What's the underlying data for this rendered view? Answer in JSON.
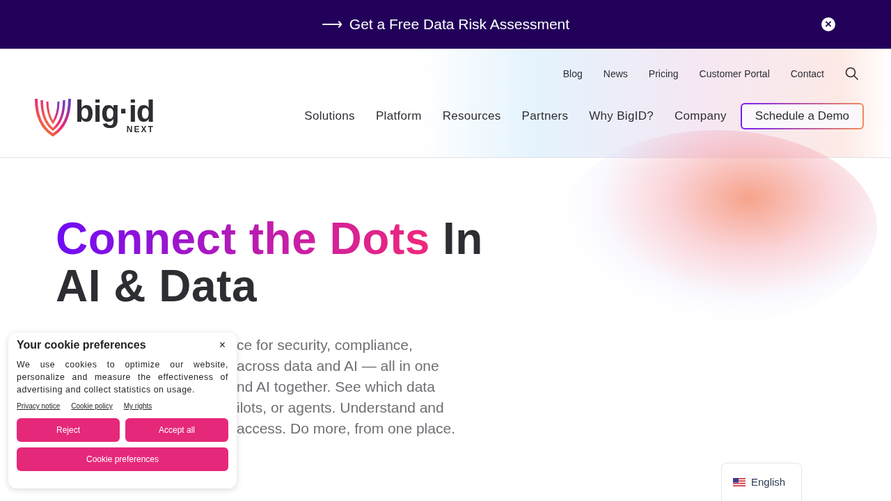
{
  "banner": {
    "arrow": "⟶",
    "text": "Get a Free Data Risk Assessment",
    "close": "×"
  },
  "logo": {
    "word": "big·id",
    "sub": "NEXT"
  },
  "top_links": [
    "Blog",
    "News",
    "Pricing",
    "Customer Portal",
    "Contact"
  ],
  "main_nav": [
    "Solutions",
    "Platform",
    "Resources",
    "Partners",
    "Why BigID?",
    "Company"
  ],
  "cta": "Schedule a Demo",
  "hero": {
    "title_highlight": "Connect the Dots",
    "title_rest": "In AI & Data",
    "paragraph_lines": [
      "ce for security, compliance,",
      "across data and AI — all in one",
      "nd AI together. See which data",
      "ilots, or agents. Understand and",
      "access. Do more, from one place."
    ]
  },
  "cookie": {
    "title": "Your cookie preferences",
    "close": "×",
    "text": "We use cookies to optimize our website, personalize and measure the effectiveness of advertising and collect statistics on usage.",
    "links": [
      "Privacy notice",
      "Cookie policy",
      "My rights"
    ],
    "buttons": [
      "Reject",
      "Accept all"
    ],
    "wide_button": "Cookie preferences"
  },
  "language": {
    "label": "English"
  }
}
